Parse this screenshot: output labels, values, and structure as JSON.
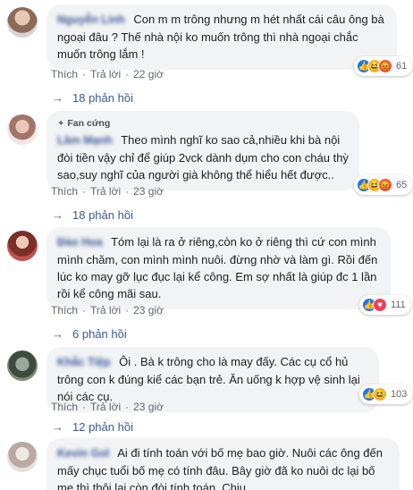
{
  "common": {
    "like_label": "Thích",
    "reply_label": "Trả lời",
    "separator": "·"
  },
  "comments": [
    {
      "author": "Nguyễn Linh",
      "text": "Con m m trông nhưng m hét nhất cái câu ông bà ngoại đâu ? Thế nhà nội ko muốn trông thì nhà ngoại chắc muốn trông lắm !",
      "time": "22 giờ",
      "reaction_count": "61",
      "reactions": [
        "like",
        "haha",
        "angry"
      ],
      "replies_label": "18 phản hồi"
    },
    {
      "author": "Lâm Mạnh",
      "badge_label": "Fan cứng",
      "text": "Theo mình nghĩ ko sao cả,nhiều khi bà nội đòi tiền vậy chỉ để giúp 2vck dành dụm cho con cháu thỳ sao,suy nghĩ của người già không thể hiểu hết được..",
      "time": "23 giờ",
      "reaction_count": "65",
      "reactions": [
        "like",
        "haha",
        "angry"
      ],
      "replies_label": "18 phản hồi"
    },
    {
      "author": "Đào Hoa",
      "text": "Tóm lại là ra ở riêng,còn ko ở riêng thì cứ con mình mình chăm, con mình mình nuôi. đừng nhờ và làm gì. Rồi đến lúc ko may gỡ lục đục lại kể công. Em sợ nhất là giúp đc 1 lần rồi kể công mãi sau.",
      "time": "23 giờ",
      "reaction_count": "111",
      "reactions": [
        "like",
        "love"
      ],
      "replies_label": "6 phản hồi"
    },
    {
      "author": "Khắc Tiệp",
      "text": "Ôi . Bà k trông cho là may đấy. Các cụ cổ hủ trông con k đúng kiể các bạn trẻ. Ăn uống k hợp vệ sinh lại nói các cụ.",
      "time": "23 giờ",
      "reaction_count": "103",
      "reactions": [
        "like",
        "haha"
      ],
      "replies_label": "12 phản hồi"
    },
    {
      "author": "Kevin Gol",
      "text": "Ai đi tính toán với bố mẹ bao giờ. Nuôi các ông đến mấy chục tuổi bố mẹ có tính đâu. Bây giờ đã ko nuôi dc lại bố mẹ thì thôi lại còn đòi tính toán. Chịu..."
    }
  ],
  "colors": {
    "link": "#385898",
    "meta": "#606770",
    "bubble_bg": "#f2f3f5",
    "like": "#1877f2",
    "haha": "#f7b125",
    "angry": "#e8563f",
    "love": "#f33e58"
  }
}
